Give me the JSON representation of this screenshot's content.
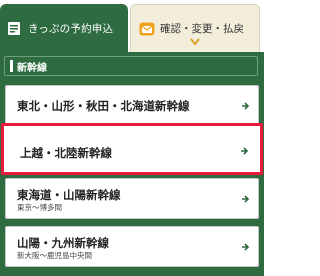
{
  "tabs": {
    "active_label": "きっぷの予約申込",
    "inactive_label": "確認・変更・払戻"
  },
  "section": {
    "title": "新幹線"
  },
  "items": [
    {
      "title": "東北・山形・秋田・北海道新幹線",
      "sub": ""
    },
    {
      "title": "上越・北陸新幹線",
      "sub": ""
    },
    {
      "title": "東海道・山陽新幹線",
      "sub": "東京〜博多間"
    },
    {
      "title": "山陽・九州新幹線",
      "sub": "新大阪〜鹿児島中央間"
    }
  ],
  "colors": {
    "brand_green": "#2e6b40",
    "highlight_red": "#e8193a",
    "tab_inactive_bg": "#f2eedb"
  }
}
